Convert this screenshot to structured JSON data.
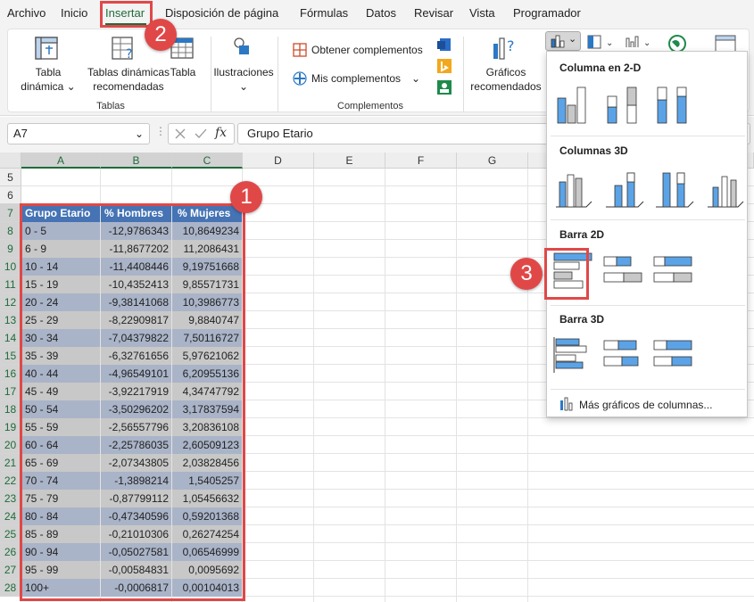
{
  "menu": {
    "tabs": [
      "Archivo",
      "Inicio",
      "Insertar",
      "Disposición de página",
      "Fórmulas",
      "Datos",
      "Revisar",
      "Vista",
      "Programador"
    ],
    "active": "Insertar"
  },
  "ribbon": {
    "pivot_label": "Tabla\ndinámica ⌄",
    "rec_pivot_label": "Tablas dinámicas\nrecomendadas",
    "table_label": "Tabla",
    "tables_group": "Tablas",
    "illustrations_label": "Ilustraciones\n⌄",
    "get_addins_label": "Obtener complementos",
    "my_addins_label": "Mis complementos",
    "addins_group": "Complementos",
    "rec_charts_label": "Gráficos\nrecomendados"
  },
  "formula_bar": {
    "name_box": "A7",
    "formula": "Grupo Etario"
  },
  "grid": {
    "columns": [
      "A",
      "B",
      "C",
      "D",
      "E",
      "F",
      "G"
    ],
    "row_numbers": [
      "5",
      "6",
      "7",
      "8",
      "9",
      "10",
      "11",
      "12",
      "13",
      "14",
      "15",
      "16",
      "17",
      "18",
      "19",
      "20",
      "21",
      "22",
      "23",
      "24",
      "25",
      "26",
      "27",
      "28"
    ],
    "headers": [
      "Grupo Etario",
      "% Hombres",
      "% Mujeres"
    ],
    "rows": [
      [
        "0 - 5",
        "-12,9786343",
        "10,8649234"
      ],
      [
        "6 - 9",
        "-11,8677202",
        "11,2086431"
      ],
      [
        "10 - 14",
        "-11,4408446",
        "9,19751668"
      ],
      [
        "15 - 19",
        "-10,4352413",
        "9,85571731"
      ],
      [
        "20 - 24",
        "-9,38141068",
        "10,3986773"
      ],
      [
        "25 - 29",
        "-8,22909817",
        "9,8840747"
      ],
      [
        "30 - 34",
        "-7,04379822",
        "7,50116727"
      ],
      [
        "35 - 39",
        "-6,32761656",
        "5,97621062"
      ],
      [
        "40 - 44",
        "-4,96549101",
        "6,20955136"
      ],
      [
        "45 - 49",
        "-3,92217919",
        "4,34747792"
      ],
      [
        "50 - 54",
        "-3,50296202",
        "3,17837594"
      ],
      [
        "55 - 59",
        "-2,56557796",
        "3,20836108"
      ],
      [
        "60 - 64",
        "-2,25786035",
        "2,60509123"
      ],
      [
        "65 - 69",
        "-2,07343805",
        "2,03828456"
      ],
      [
        "70 - 74",
        "-1,3898214",
        "1,5405257"
      ],
      [
        "75 - 79",
        "-0,87799112",
        "1,05456632"
      ],
      [
        "80 - 84",
        "-0,47340596",
        "0,59201368"
      ],
      [
        "85 - 89",
        "-0,21010306",
        "0,26274254"
      ],
      [
        "90 - 94",
        "-0,05027581",
        "0,06546999"
      ],
      [
        "95 - 99",
        "-0,00584831",
        "0,0095692"
      ],
      [
        "100+",
        "-0,0006817",
        "0,00104013"
      ]
    ]
  },
  "dropdown": {
    "sections": [
      "Columna en 2-D",
      "Columnas 3D",
      "Barra 2D",
      "Barra 3D"
    ],
    "more_link": "Más gráficos de columnas..."
  },
  "badges": [
    "1",
    "2",
    "3"
  ],
  "colors": {
    "accent_green": "#1e6b3a",
    "highlight_red": "#e04848",
    "header_blue": "#4573b3",
    "chart_blue": "#5ba3e6"
  }
}
